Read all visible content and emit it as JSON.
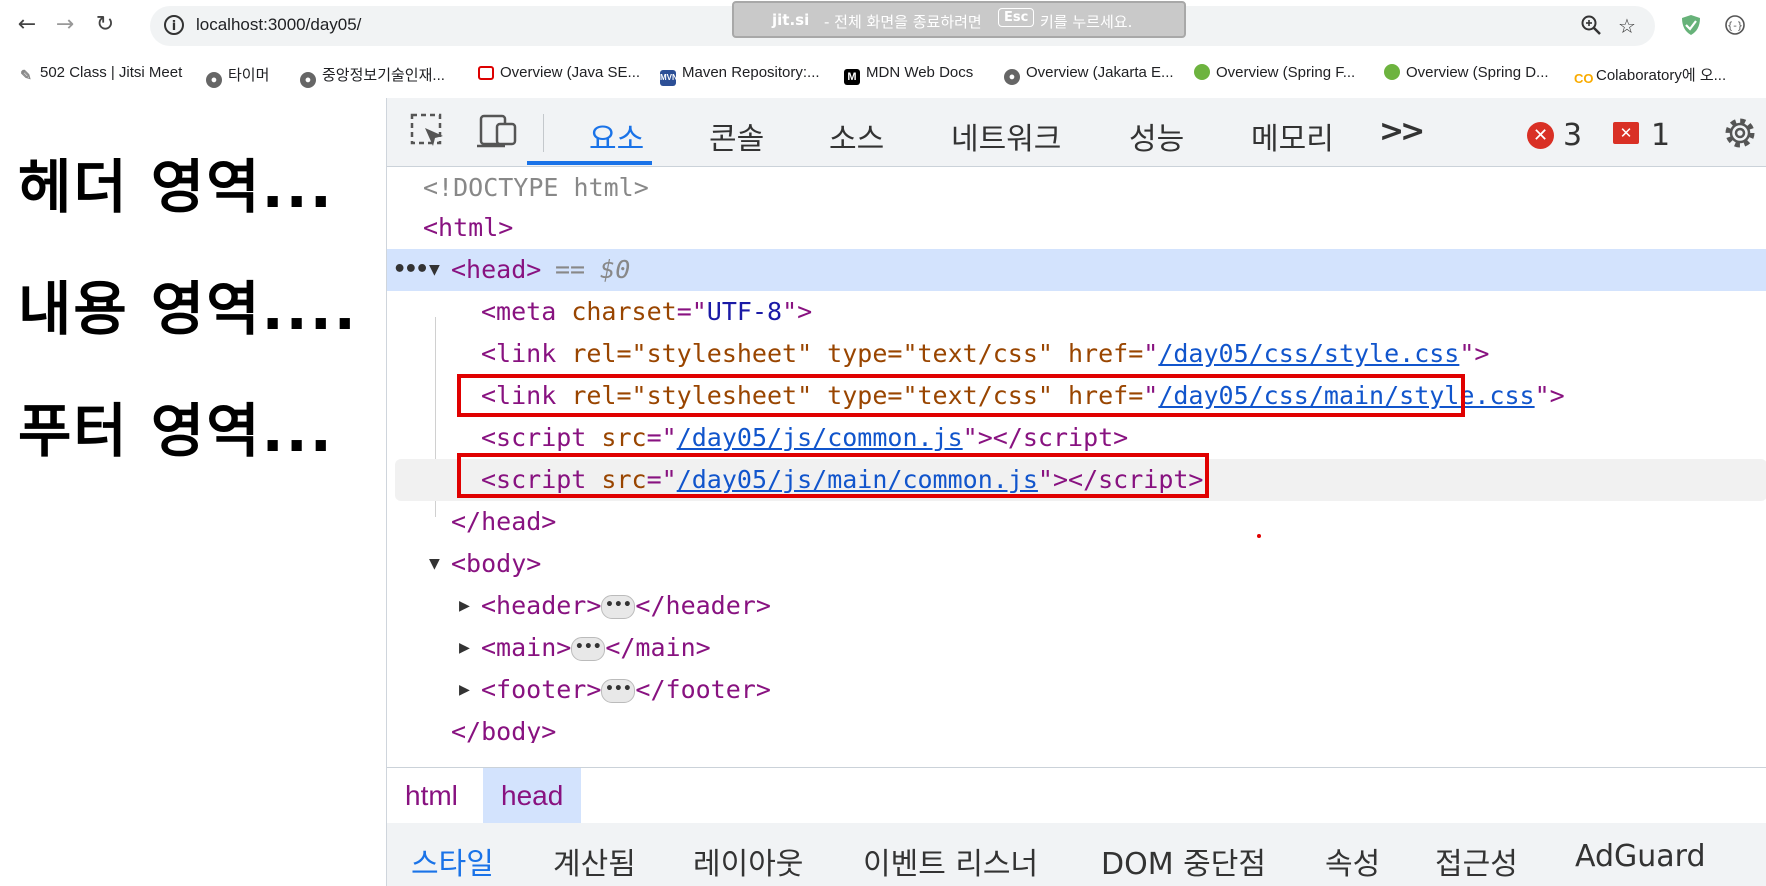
{
  "browser": {
    "url": "localhost:3000/day05/",
    "toast": {
      "brand": "jit.si",
      "message_before": "- 전체 화면을 종료하려면",
      "key": "Esc",
      "message_after": "키를 누르세요."
    },
    "bookmarks": [
      {
        "label": "502 Class | Jitsi Meet",
        "icon": "jitsi-icon"
      },
      {
        "label": "타이머",
        "icon": "globe-icon"
      },
      {
        "label": "중앙정보기술인재...",
        "icon": "globe-icon"
      },
      {
        "label": "Overview (Java SE...",
        "icon": "oracle-icon"
      },
      {
        "label": "Maven Repository:...",
        "icon": "maven-icon"
      },
      {
        "label": "MDN Web Docs",
        "icon": "mdn-icon"
      },
      {
        "label": "Overview (Jakarta E...",
        "icon": "globe-icon"
      },
      {
        "label": "Overview (Spring F...",
        "icon": "spring-icon"
      },
      {
        "label": "Overview (Spring D...",
        "icon": "spring-icon"
      },
      {
        "label": "Colaboratory에 오...",
        "icon": "colab-icon"
      }
    ]
  },
  "page": {
    "header_text": "헤더 영역...",
    "main_text": "내용 영역....",
    "footer_text": "푸터 영역..."
  },
  "devtools": {
    "tabs": [
      "요소",
      "콘솔",
      "소스",
      "네트워크",
      "성능",
      "메모리"
    ],
    "more_tabs": ">>",
    "error_count": "3",
    "issue_count": "1",
    "tree": {
      "doctype": "<!DOCTYPE html>",
      "html_open": "<html>",
      "head_open": "<head>",
      "head_marker": "== $0",
      "meta": {
        "tag": "<meta",
        "attr": "charset",
        "value": "UTF-8"
      },
      "link1": {
        "attrs": "rel=\"stylesheet\" type=\"text/css\" href=",
        "href": "/day05/css/style.css"
      },
      "link2": {
        "attrs": "rel=\"stylesheet\" type=\"text/css\" href=",
        "href": "/day05/css/main/style.css"
      },
      "script1": {
        "src": "/day05/js/common.js"
      },
      "script2": {
        "src": "/day05/js/main/common.js"
      },
      "head_close": "</head>",
      "body_open": "<body>",
      "header": [
        "<header>",
        "</header>"
      ],
      "main": [
        "<main>",
        "</main>"
      ],
      "footer": [
        "<footer>",
        "</footer>"
      ],
      "body_close": "</body>"
    },
    "breadcrumbs": [
      "html",
      "head"
    ],
    "sub_tabs": [
      "스타일",
      "계산됨",
      "레이아웃",
      "이벤트 리스너",
      "DOM 중단점",
      "속성",
      "접근성",
      "AdGuard"
    ]
  }
}
